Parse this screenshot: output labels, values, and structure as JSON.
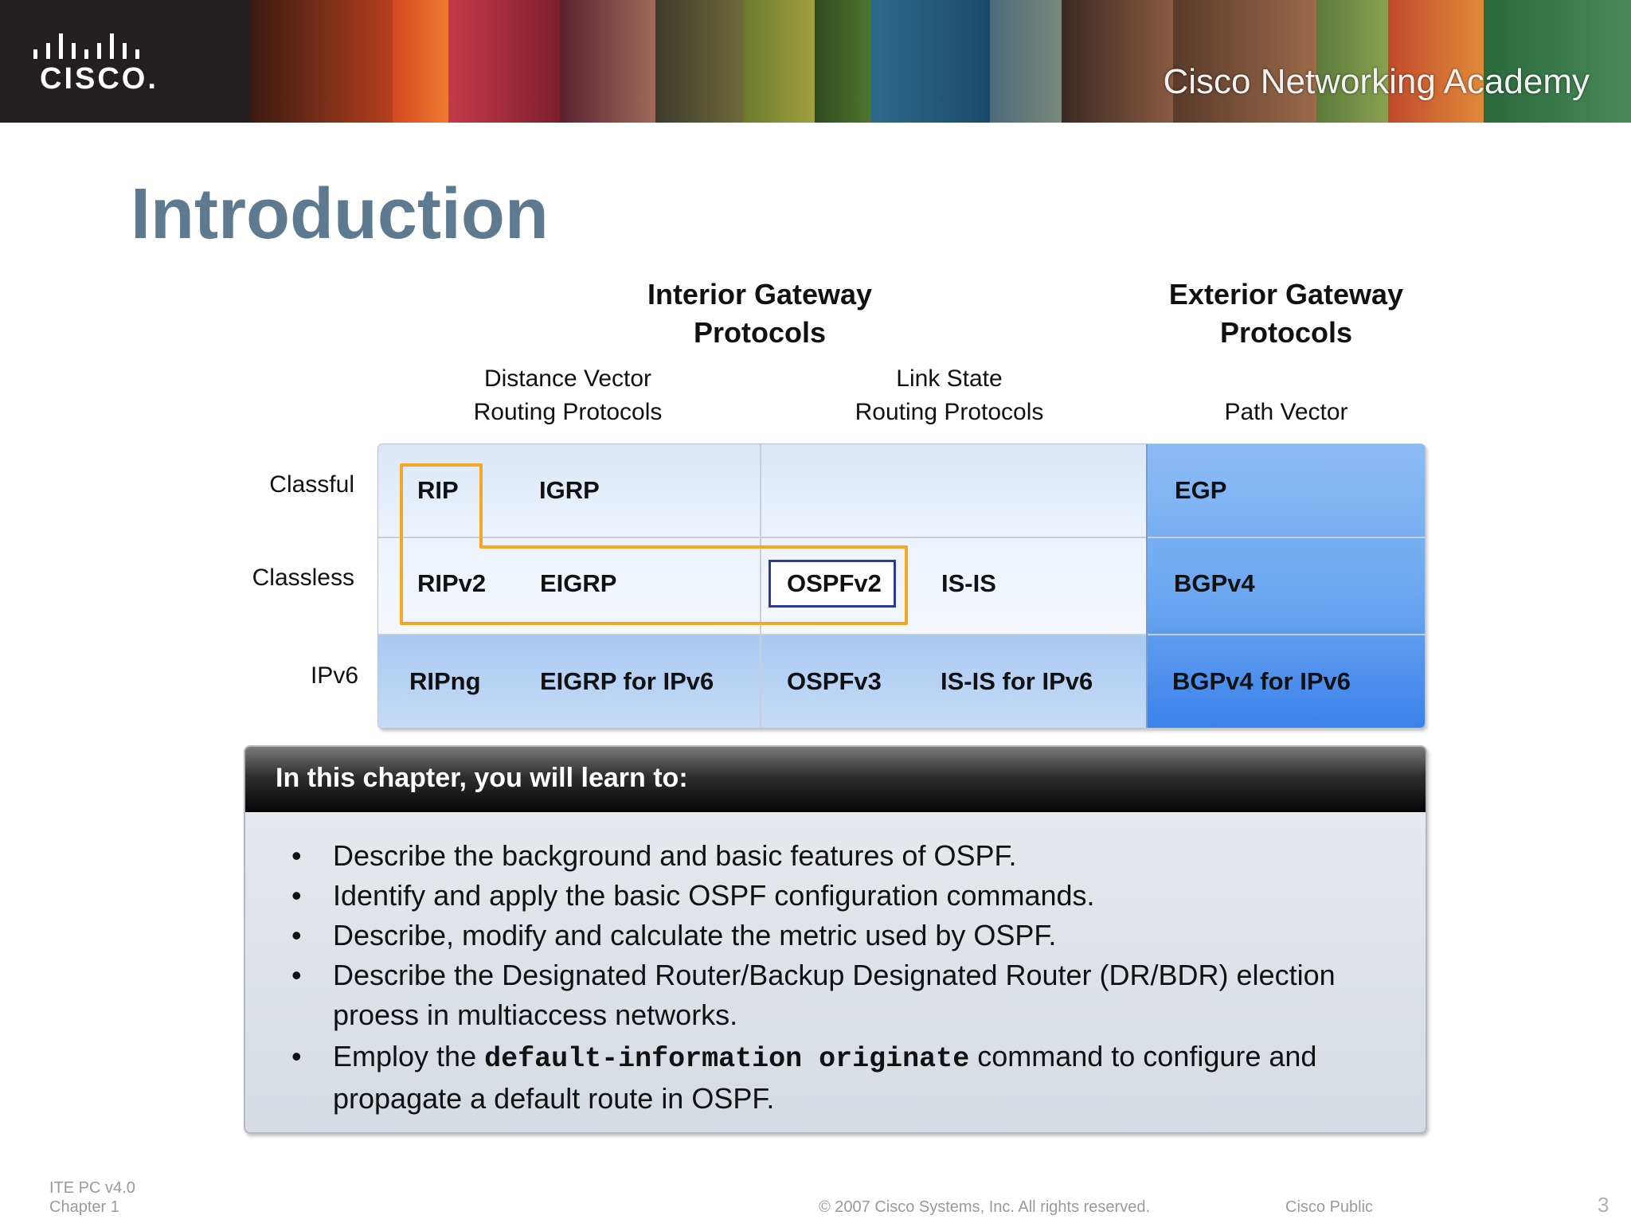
{
  "header": {
    "logo_text": "CISCO.",
    "academy_text": "Cisco Networking Academy"
  },
  "slide": {
    "title": "Introduction"
  },
  "diagram": {
    "igp_header": [
      "Interior Gateway",
      "Protocols"
    ],
    "egp_header": [
      "Exterior Gateway",
      "Protocols"
    ],
    "dv_header": [
      "Distance Vector",
      "Routing Protocols"
    ],
    "ls_header": [
      "Link State",
      "Routing Protocols"
    ],
    "pv_header": "Path Vector",
    "rows": [
      "Classful",
      "Classless",
      "IPv6"
    ],
    "cells": {
      "classful": [
        "RIP",
        "IGRP",
        "EGP"
      ],
      "classless": [
        "RIPv2",
        "EIGRP",
        "OSPFv2",
        "IS-IS",
        "BGPv4"
      ],
      "ipv6": [
        "RIPng",
        "EIGRP for IPv6",
        "OSPFv3",
        "IS-IS for IPv6",
        "BGPv4 for IPv6"
      ]
    },
    "colors": {
      "highlight_outline": "#f5a623",
      "ospf_box": "#2b3a9a"
    }
  },
  "chapter": {
    "heading": "In this chapter, you will learn to:",
    "bullet": "•",
    "items": [
      "Describe the background and basic features of OSPF.",
      "Identify and apply the basic OSPF configuration commands.",
      "Describe, modify and calculate the metric used by OSPF.",
      "Describe the Designated Router/Backup Designated Router (DR/BDR) election",
      "proess in multiaccess networks."
    ],
    "last_item": {
      "before": "Employ the ",
      "code": "default-information originate",
      "after": " command to configure and",
      "line2": "propagate a default route in OSPF."
    }
  },
  "footer": {
    "left_line1": "ITE PC v4.0",
    "left_line2": "Chapter 1",
    "copyright": "© 2007 Cisco Systems, Inc. All rights reserved.",
    "classification": "Cisco Public",
    "page_number": "3"
  }
}
